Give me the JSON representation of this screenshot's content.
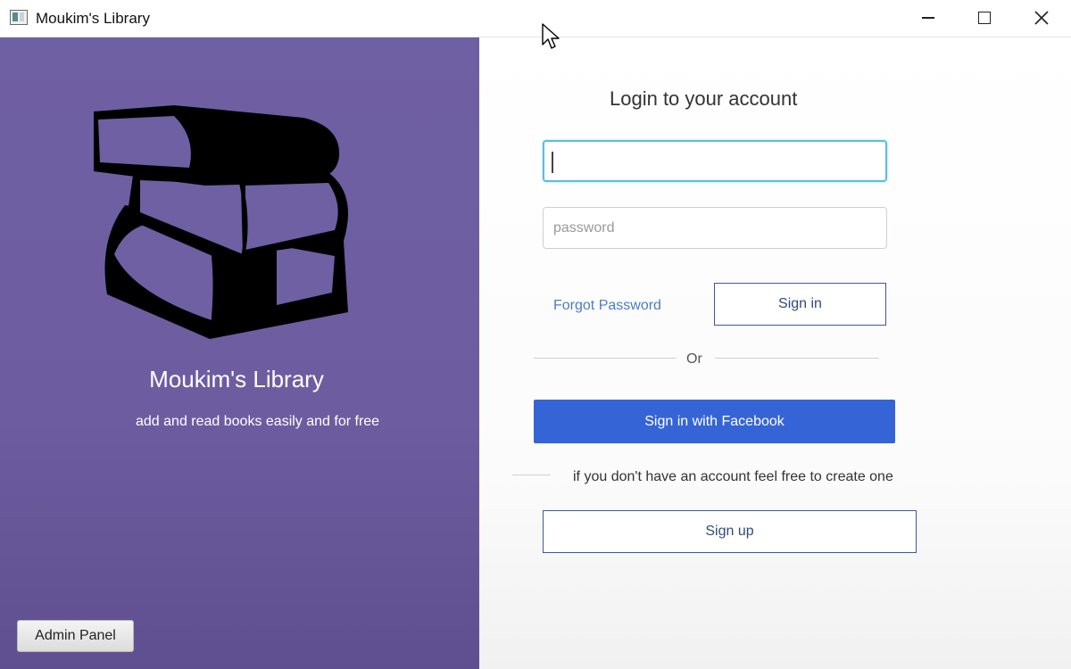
{
  "window": {
    "title": "Moukim's Library",
    "controls": [
      "minimize",
      "maximize",
      "close"
    ]
  },
  "left_panel": {
    "logo_icon": "stacked-books-icon",
    "brand_title": "Moukim's Library",
    "subtitle": "add and read books easily and for free",
    "admin_button_label": "Admin Panel",
    "background_color": "#6f5fa3"
  },
  "login": {
    "heading": "Login to your account",
    "username": {
      "value": "",
      "placeholder": ""
    },
    "password": {
      "value": "",
      "placeholder": "password"
    },
    "forgot_password_label": "Forgot Password",
    "sign_in_label": "Sign in",
    "or_label": "Or",
    "facebook_label": "Sign in with Facebook",
    "signup_hint": "if you don't have an account feel free to create one",
    "sign_up_label": "Sign up"
  },
  "colors": {
    "facebook_button": "#3564d6",
    "focus_border": "#5bbde3",
    "link": "#4a7cc9",
    "button_border": "#3a5a96"
  }
}
